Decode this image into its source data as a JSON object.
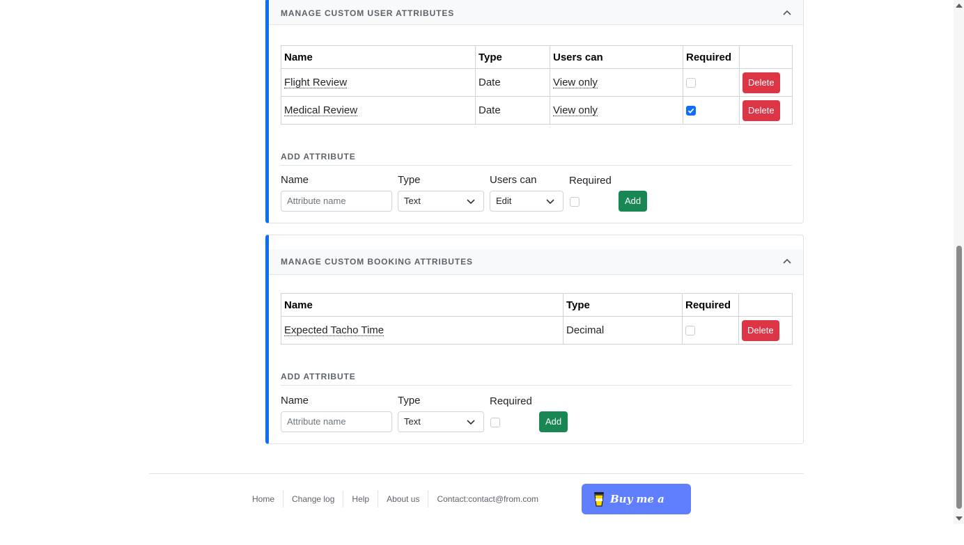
{
  "user_section": {
    "title": "MANAGE CUSTOM USER ATTRIBUTES",
    "headers": [
      "Name",
      "Type",
      "Users can",
      "Required",
      ""
    ],
    "rows": [
      {
        "name": "Flight Review",
        "type": "Date",
        "users_can": "View only",
        "required": false,
        "action": "Delete"
      },
      {
        "name": "Medical Review",
        "type": "Date",
        "users_can": "View only",
        "required": true,
        "action": "Delete"
      }
    ],
    "add_title": "ADD ATTRIBUTE",
    "labels": {
      "name": "Name",
      "type": "Type",
      "users_can": "Users can",
      "required": "Required"
    },
    "name_placeholder": "Attribute name",
    "type_value": "Text",
    "users_can_value": "Edit",
    "add_button": "Add"
  },
  "booking_section": {
    "title": "MANAGE CUSTOM BOOKING ATTRIBUTES",
    "headers": [
      "Name",
      "Type",
      "Required",
      ""
    ],
    "rows": [
      {
        "name": "Expected Tacho Time",
        "type": "Decimal",
        "required": false,
        "action": "Delete"
      }
    ],
    "add_title": "ADD ATTRIBUTE",
    "labels": {
      "name": "Name",
      "type": "Type",
      "required": "Required"
    },
    "name_placeholder": "Attribute name",
    "type_value": "Text",
    "add_button": "Add"
  },
  "footer": {
    "links": [
      "Home",
      "Change log",
      "Help",
      "About us",
      "Contact:contact@from.com"
    ],
    "coffee_label": "Buy me a coffee"
  },
  "colors": {
    "accent": "#0d6efd",
    "danger": "#dc3545",
    "success": "#198754",
    "coffee": "#5f7fff"
  }
}
